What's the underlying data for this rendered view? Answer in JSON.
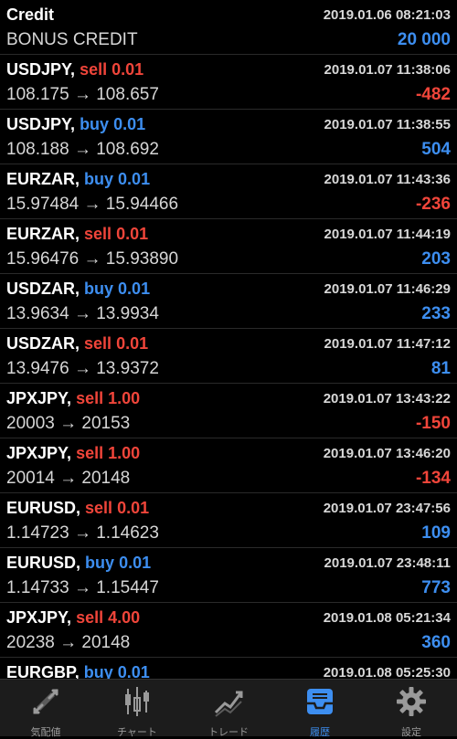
{
  "credit": {
    "title": "Credit",
    "time": "2019.01.06 08:21:03",
    "label": "BONUS CREDIT",
    "amount": "20 000"
  },
  "trades": [
    {
      "symbol": "USDJPY,",
      "side": "sell",
      "lots": "0.01",
      "time": "2019.01.07 11:38:06",
      "prices": "108.175 → 108.657",
      "profit": "-482"
    },
    {
      "symbol": "USDJPY,",
      "side": "buy",
      "lots": "0.01",
      "time": "2019.01.07 11:38:55",
      "prices": "108.188 → 108.692",
      "profit": "504"
    },
    {
      "symbol": "EURZAR,",
      "side": "buy",
      "lots": "0.01",
      "time": "2019.01.07 11:43:36",
      "prices": "15.97484 → 15.94466",
      "profit": "-236"
    },
    {
      "symbol": "EURZAR,",
      "side": "sell",
      "lots": "0.01",
      "time": "2019.01.07 11:44:19",
      "prices": "15.96476 → 15.93890",
      "profit": "203"
    },
    {
      "symbol": "USDZAR,",
      "side": "buy",
      "lots": "0.01",
      "time": "2019.01.07 11:46:29",
      "prices": "13.9634 → 13.9934",
      "profit": "233"
    },
    {
      "symbol": "USDZAR,",
      "side": "sell",
      "lots": "0.01",
      "time": "2019.01.07 11:47:12",
      "prices": "13.9476 → 13.9372",
      "profit": "81"
    },
    {
      "symbol": "JPXJPY,",
      "side": "sell",
      "lots": "1.00",
      "time": "2019.01.07 13:43:22",
      "prices": "20003 → 20153",
      "profit": "-150"
    },
    {
      "symbol": "JPXJPY,",
      "side": "sell",
      "lots": "1.00",
      "time": "2019.01.07 13:46:20",
      "prices": "20014 → 20148",
      "profit": "-134"
    },
    {
      "symbol": "EURUSD,",
      "side": "sell",
      "lots": "0.01",
      "time": "2019.01.07 23:47:56",
      "prices": "1.14723 → 1.14623",
      "profit": "109"
    },
    {
      "symbol": "EURUSD,",
      "side": "buy",
      "lots": "0.01",
      "time": "2019.01.07 23:48:11",
      "prices": "1.14733 → 1.15447",
      "profit": "773"
    },
    {
      "symbol": "JPXJPY,",
      "side": "sell",
      "lots": "4.00",
      "time": "2019.01.08 05:21:34",
      "prices": "20238 → 20148",
      "profit": "360"
    },
    {
      "symbol": "EURGBP,",
      "side": "buy",
      "lots": "0.01",
      "time": "2019.01.08 05:25:30",
      "prices": "",
      "profit": ""
    }
  ],
  "tabs": [
    {
      "label": "気配値",
      "icon": "quotes-icon",
      "active": false
    },
    {
      "label": "チャート",
      "icon": "chart-icon",
      "active": false
    },
    {
      "label": "トレード",
      "icon": "trade-icon",
      "active": false
    },
    {
      "label": "履歴",
      "icon": "history-icon",
      "active": true
    },
    {
      "label": "設定",
      "icon": "settings-icon",
      "active": false
    }
  ],
  "colors": {
    "sell": "#f0453a",
    "buy": "#3d8ef0",
    "active_tab": "#3d8ef0",
    "inactive_tab": "#9a9a9a"
  }
}
